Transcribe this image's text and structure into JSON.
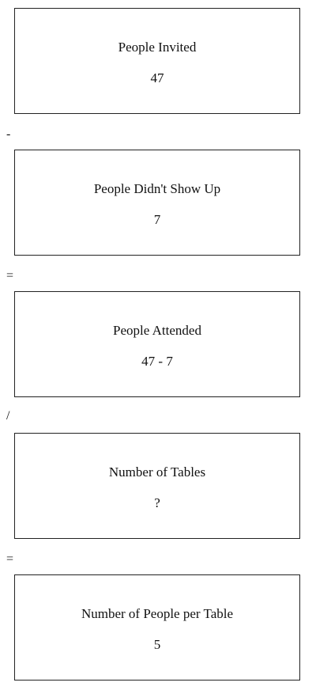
{
  "boxes": [
    {
      "title": "People Invited",
      "value": "47"
    },
    {
      "title": "People Didn't Show Up",
      "value": "7"
    },
    {
      "title": "People Attended",
      "value": "47 - 7"
    },
    {
      "title": "Number of Tables",
      "value": "?"
    },
    {
      "title": "Number of People per Table",
      "value": "5"
    }
  ],
  "operators": [
    "-",
    "=",
    "/",
    "="
  ]
}
